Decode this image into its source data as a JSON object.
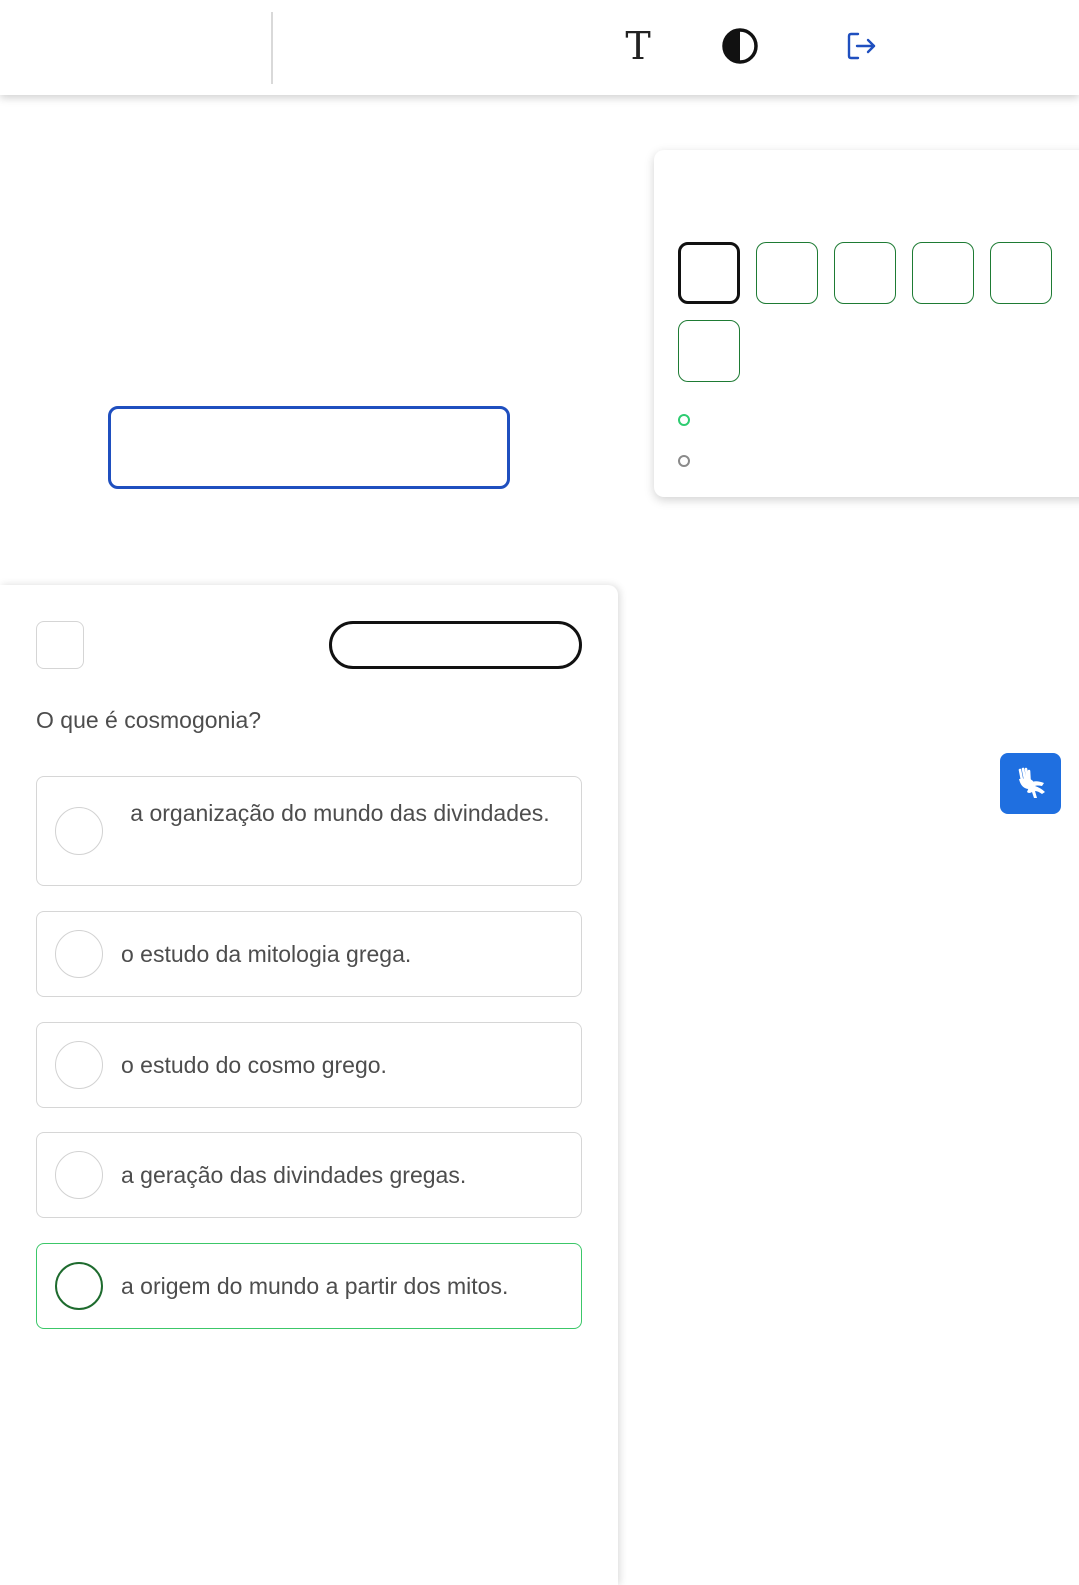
{
  "header": {
    "font_size_icon": "font-size-icon",
    "contrast_icon": "contrast-icon",
    "logout_icon": "logout-icon",
    "font_glyph": "T",
    "logout_color": "#1f4fbf"
  },
  "question_nav": {
    "boxes": [
      {
        "state": "current"
      },
      {
        "state": "answered"
      },
      {
        "state": "answered"
      },
      {
        "state": "answered"
      },
      {
        "state": "answered"
      },
      {
        "state": "answered"
      }
    ],
    "legend": [
      {
        "color": "#2ecc71"
      },
      {
        "color": "#8a8a8a"
      }
    ]
  },
  "question": {
    "text": "O que é cosmogonia?",
    "options": [
      {
        "label": "a organização do mundo das divindades.",
        "selected": false
      },
      {
        "label": "o estudo da mitologia grega.",
        "selected": false
      },
      {
        "label": "o estudo do cosmo grego.",
        "selected": false
      },
      {
        "label": "a geração das divindades gregas.",
        "selected": false
      },
      {
        "label": "a origem do mundo a partir dos mitos.",
        "selected": true
      }
    ]
  },
  "accessibility": {
    "icon": "sign-language-hands-icon",
    "color": "#1f6fe0"
  },
  "colors": {
    "selected_border": "#3cc769",
    "answered_box": "#1e7b34",
    "blue_outline": "#1f4fbf"
  }
}
